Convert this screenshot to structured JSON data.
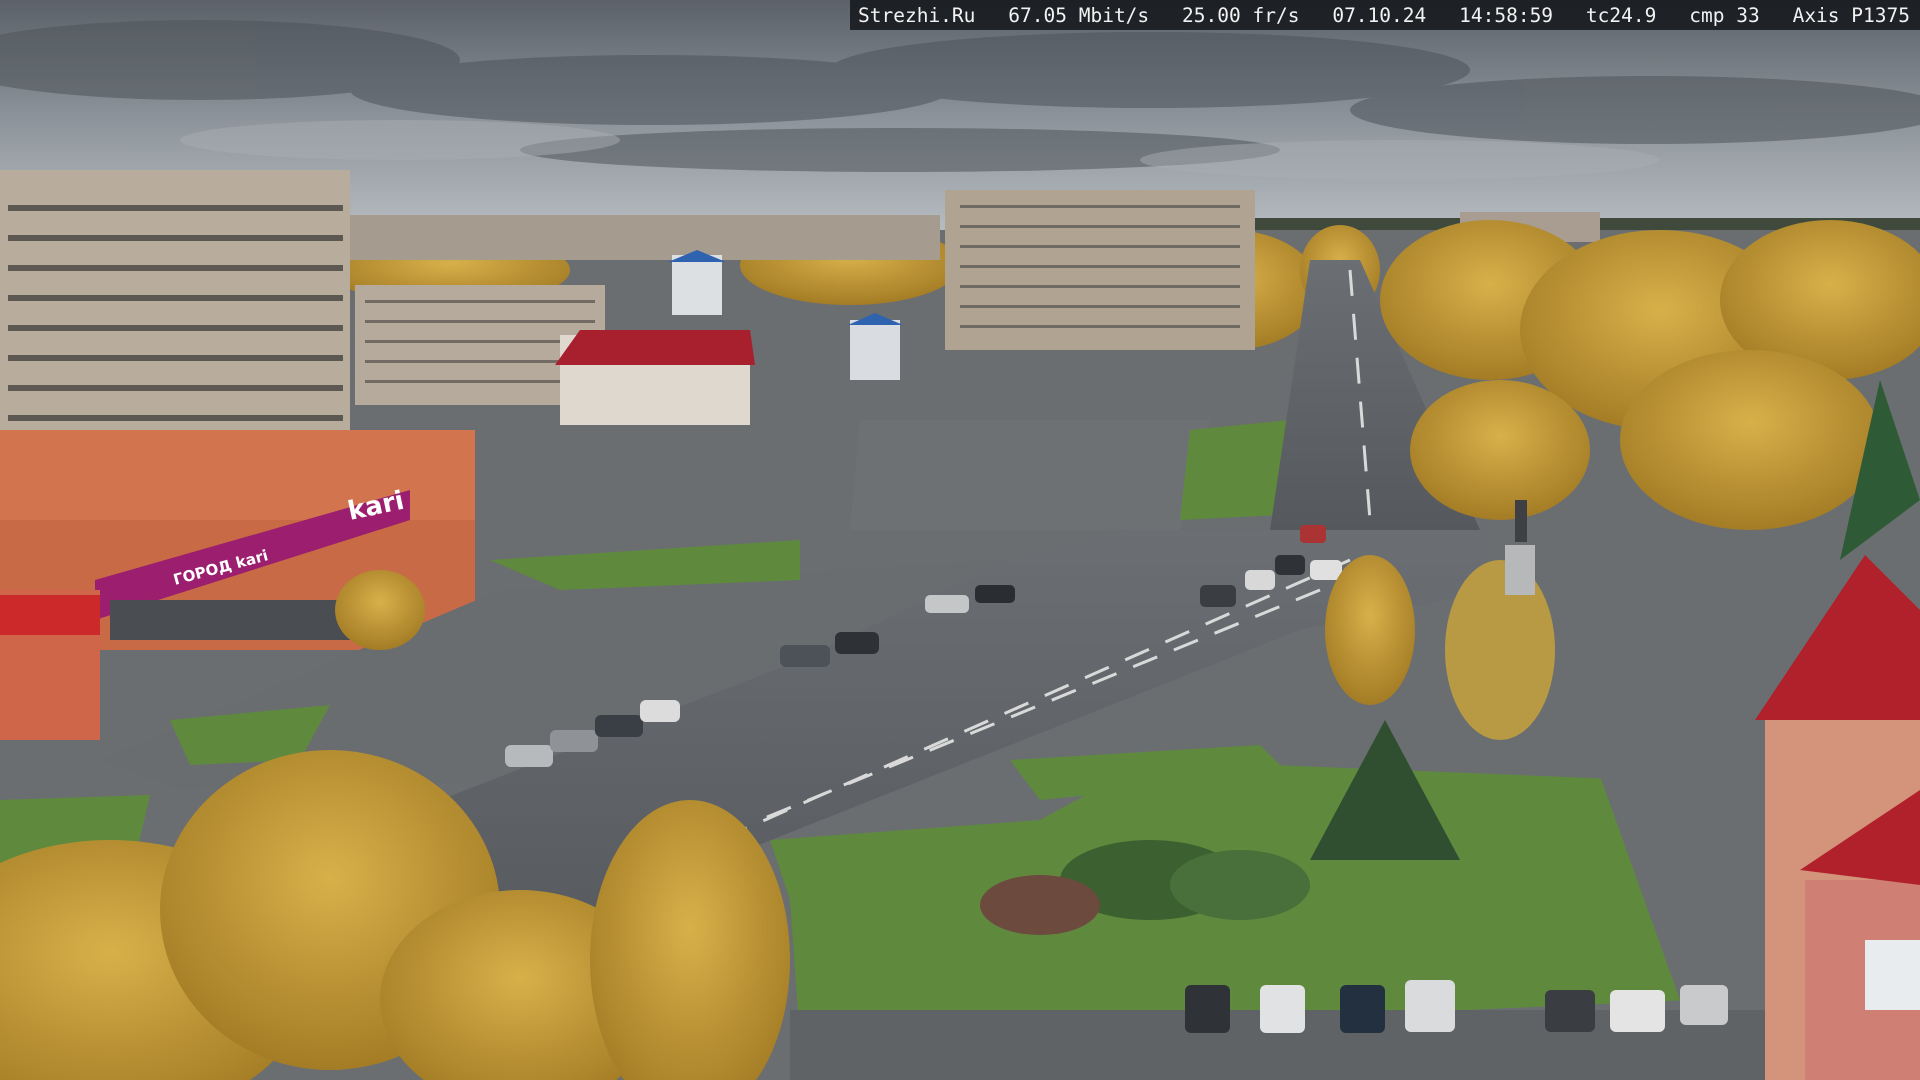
{
  "overlay": {
    "site": "Strezhi.Ru",
    "bitrate": "67.05 Mbit/s",
    "framerate": "25.00 fr/s",
    "date": "07.10.24",
    "time": "14:58:59",
    "temperature": "tc24.9",
    "compression": "cmp 33",
    "camera_model": "Axis P1375"
  },
  "signage": {
    "store_brand": "kari",
    "store_facade_text": "ГОРОД kari"
  },
  "colors": {
    "sky": "#7f878f",
    "foliage_yellow": "#c9a23a",
    "grass": "#5f8a3e",
    "asphalt": "#606468",
    "brand_magenta": "#9b1f6e",
    "roof_red": "#b0212c"
  }
}
